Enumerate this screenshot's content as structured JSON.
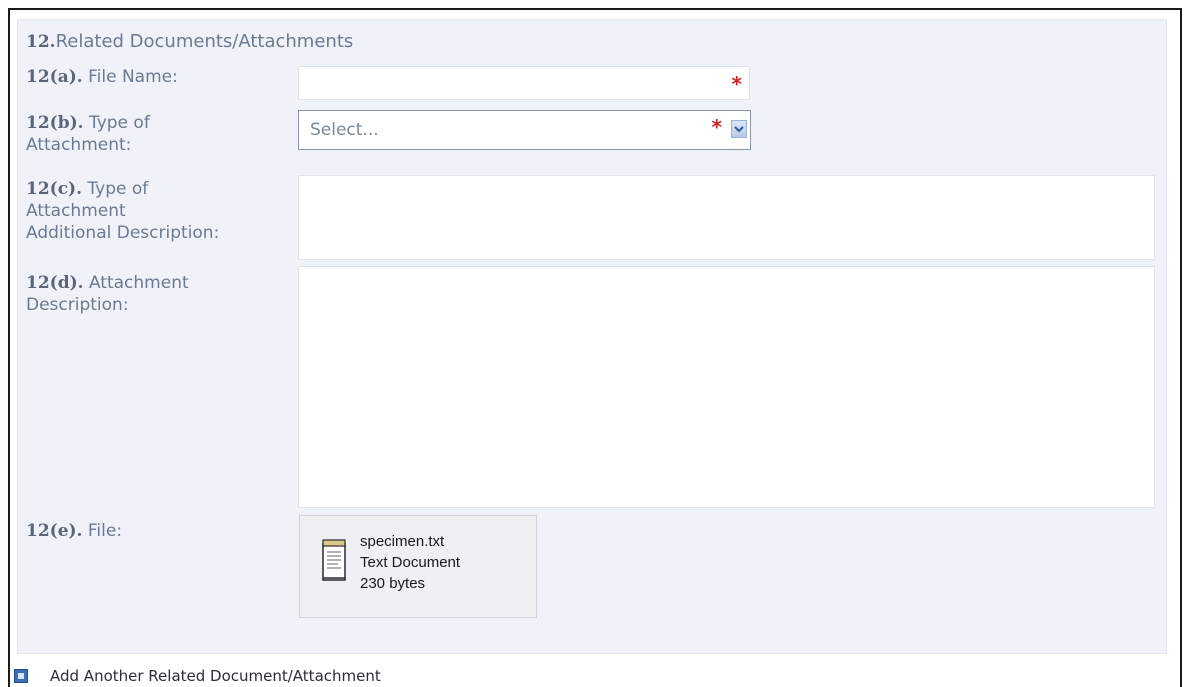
{
  "section": {
    "number": "12.",
    "title": "Related Documents/Attachments"
  },
  "fields": {
    "file_name": {
      "number": "12(a).",
      "label": "File Name:",
      "value": "",
      "required_marker": "*"
    },
    "type_of_attachment": {
      "number": "12(b).",
      "label_line1": "Type of",
      "label_line2": "Attachment:",
      "selected": "Select...",
      "required_marker": "*"
    },
    "type_additional_description": {
      "number": "12(c).",
      "label_line1": "Type of",
      "label_line2": "Attachment",
      "label_line3": "Additional Description:",
      "value": ""
    },
    "attachment_description": {
      "number": "12(d).",
      "label_line1": "Attachment",
      "label_line2": "Description:",
      "value": ""
    },
    "file": {
      "number": "12(e).",
      "label": "File:",
      "file_name": "specimen.txt",
      "file_type": "Text Document",
      "file_size": "230 bytes",
      "icon": "text-document-icon"
    }
  },
  "actions": {
    "add_another_label": "Add Another Related Document/Attachment",
    "add_icon": "add-icon"
  },
  "colors": {
    "panel_background": "#eff2f9",
    "label_text": "#6b7a8f",
    "required_star": "#c8262a",
    "dropdown_accent": "#3a6fb5"
  }
}
